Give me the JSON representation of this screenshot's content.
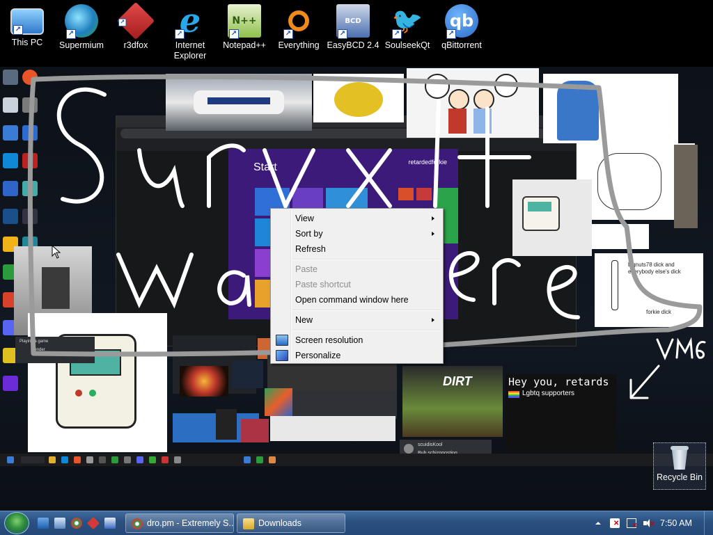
{
  "desktop_icons": [
    {
      "label": "This PC",
      "icon": "this-pc-icon",
      "color": "#3a86d6"
    },
    {
      "label": "Supermium",
      "icon": "supermium-icon",
      "color": "#2a9bd8"
    },
    {
      "label": "r3dfox",
      "icon": "r3dfox-icon",
      "color": "#d33b3b"
    },
    {
      "label": "Internet Explorer",
      "icon": "internet-explorer-icon",
      "color": "#1f8fe0"
    },
    {
      "label": "Notepad++",
      "icon": "notepad-plus-plus-icon",
      "color": "#8dbb4a"
    },
    {
      "label": "Everything",
      "icon": "everything-search-icon",
      "color": "#f08a1c"
    },
    {
      "label": "EasyBCD 2.4",
      "icon": "easybcd-icon",
      "color": "#4a6fb0"
    },
    {
      "label": "SoulseekQt",
      "icon": "soulseek-icon",
      "color": "#6a5acd"
    },
    {
      "label": "qBittorrent",
      "icon": "qbittorrent-icon",
      "color": "#3b82d6"
    }
  ],
  "scribble": {
    "line1": "Survxlt",
    "line2": "was here",
    "corner": "VM6"
  },
  "inner": {
    "start_title": "Start",
    "start_user": "retardedforkie",
    "meme_title": "Hey you, retards",
    "meme_sub": "Lgbtq supporters",
    "sticker_top": "bignuts78 dick and everybody else's dick",
    "sticker_bottom": "forkie dick",
    "chat_user": "scuidisKool",
    "chat_text": "Bub schizoposting",
    "notif_title": "Playing a game",
    "notif_app": "Blender"
  },
  "context_menu": {
    "items": [
      {
        "label": "View",
        "submenu": true,
        "enabled": true
      },
      {
        "label": "Sort by",
        "submenu": true,
        "enabled": true
      },
      {
        "label": "Refresh",
        "submenu": false,
        "enabled": true
      },
      {
        "label": "Paste",
        "submenu": false,
        "enabled": false
      },
      {
        "label": "Paste shortcut",
        "submenu": false,
        "enabled": false
      },
      {
        "label": "Open command window here",
        "submenu": false,
        "enabled": true
      },
      {
        "label": "New",
        "submenu": true,
        "enabled": true
      },
      {
        "label": "Screen resolution",
        "submenu": false,
        "enabled": true
      },
      {
        "label": "Personalize",
        "submenu": false,
        "enabled": true
      }
    ]
  },
  "recycle_bin": {
    "label": "Recycle Bin"
  },
  "taskbar": {
    "buttons": [
      {
        "label": "dro.pm - Extremely S...",
        "icon": "browser-icon"
      },
      {
        "label": "Downloads",
        "icon": "folder-icon"
      }
    ],
    "clock": "7:50 AM"
  },
  "colors": {
    "taskbar": "#2c5282",
    "menu_bg": "#f0f0f0",
    "scribble": "#ffffff",
    "border_stroke": "#9a9a9a"
  }
}
